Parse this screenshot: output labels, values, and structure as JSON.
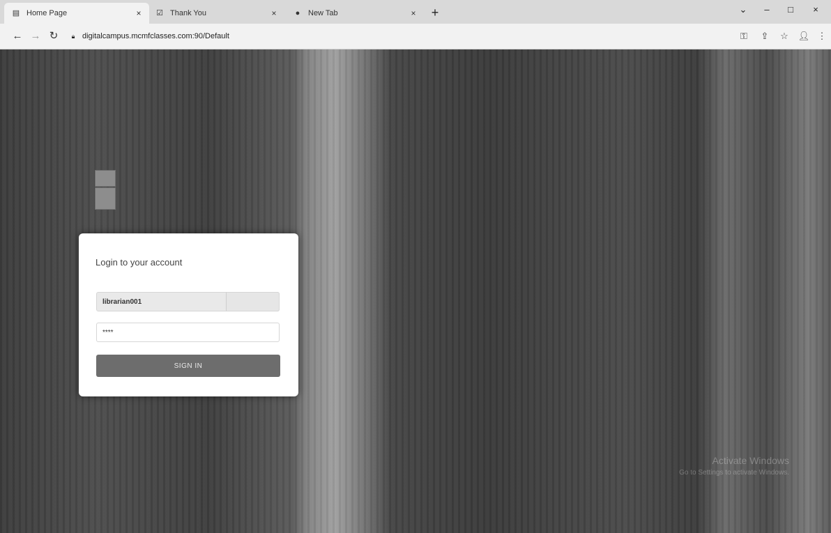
{
  "browser": {
    "tabs": [
      {
        "label": "Home Page",
        "favicon": "page-icon",
        "active": true
      },
      {
        "label": "Thank You",
        "favicon": "document-icon",
        "active": false
      },
      {
        "label": "New Tab",
        "favicon": "chrome-icon",
        "active": false
      }
    ],
    "tab_close_glyph": "×",
    "new_tab_glyph": "+",
    "address": "digitalcampus.mcmfclasses.com:90/Default"
  },
  "background": {
    "watermark_line1": "Activate Windows",
    "watermark_line2": "Go to Settings to activate Windows."
  },
  "login": {
    "title": "Login to your account",
    "username_value": "librarian001",
    "password_value": "****",
    "signin_label": "SIGN IN"
  }
}
